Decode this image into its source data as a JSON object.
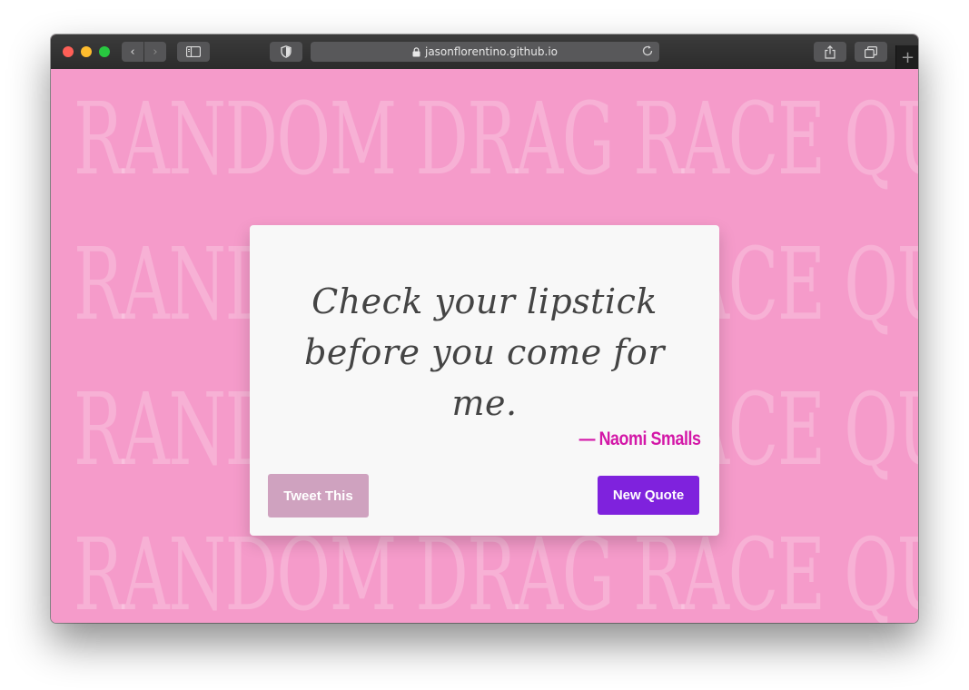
{
  "browser": {
    "url": "jasonflorentino.github.io",
    "back_glyph": "‹",
    "forward_glyph": "›",
    "newtab_glyph": "+"
  },
  "background": {
    "rows": [
      "RANDOM DRAG RACE QUOTE",
      "RANDOM DRAG RACE QUOTE",
      "RANDOM DRAG RACE QUOTE",
      "RANDOM DRAG RACE QUOTE"
    ]
  },
  "card": {
    "quote_line1": "Check your lipstick",
    "quote_line2": "before you come for me.",
    "author": "— Naomi Smalls",
    "tweet_label": "Tweet This",
    "new_quote_label": "New Quote"
  },
  "colors": {
    "page_background": "#f59bca",
    "author": "#d317a7",
    "new_quote_button": "#7f22dd",
    "tweet_button": "#cfa2bf"
  },
  "icons": [
    "lock-icon",
    "reload-icon",
    "sidebar-icon",
    "shield-icon",
    "share-icon",
    "tabs-icon",
    "chevron-left-icon",
    "chevron-right-icon",
    "plus-icon"
  ]
}
